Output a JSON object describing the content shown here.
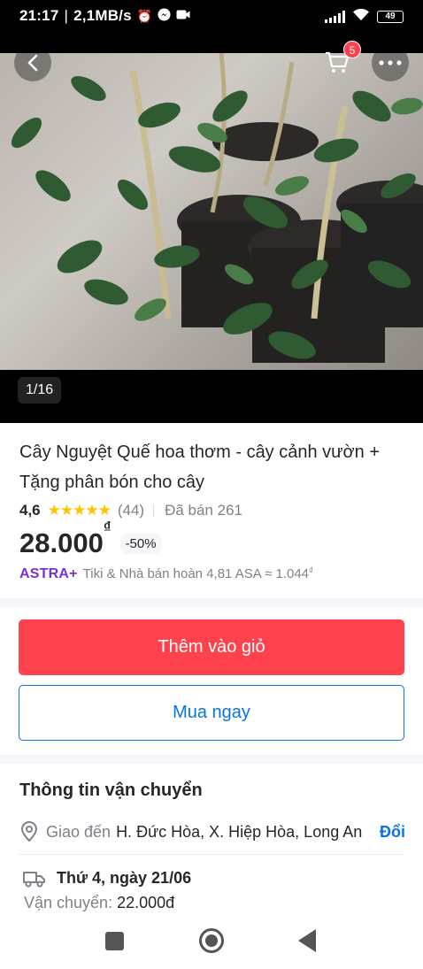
{
  "status_bar": {
    "time": "21:17",
    "network_speed": "2,1MB/s",
    "battery": "49",
    "icons": [
      "alarm-icon",
      "messenger-icon",
      "video-icon",
      "signal-icon",
      "wifi-icon",
      "battery-icon"
    ]
  },
  "gallery": {
    "counter": "1/16",
    "cart_count": "5",
    "icons": [
      "back-arrow-icon",
      "cart-icon",
      "more-dots-icon"
    ]
  },
  "product": {
    "title": "Cây Nguyệt Quế hoa thơm - cây cảnh vườn + Tặng phân bón cho cây",
    "rating": "4,6",
    "stars": 4.6,
    "review_count": "(44)",
    "sold": "Đã bán 261",
    "price": "28.000",
    "currency_symbol": "₫",
    "discount": "-50%",
    "astra_brand": "ASTRA+",
    "astra_text": "Tiki & Nhà bán hoàn 4,81 ASA ≈ 1.044",
    "astra_currency": "₫"
  },
  "actions": {
    "add_to_cart": "Thêm vào giỏ",
    "buy_now": "Mua ngay"
  },
  "shipping": {
    "heading": "Thông tin vận chuyển",
    "deliver_label": "Giao đến",
    "address": "H. Đức Hòa, X. Hiệp Hòa, Long An",
    "change_label": "Đổi",
    "delivery_date": "Thứ 4, ngày 21/06",
    "fee_label": "Vận chuyển:",
    "fee_value": "22.000đ"
  },
  "colors": {
    "primary_red": "#ff424e",
    "link_blue": "#0b74e5",
    "astra_purple": "#7a2fd6",
    "star_yellow": "#ffc400"
  }
}
